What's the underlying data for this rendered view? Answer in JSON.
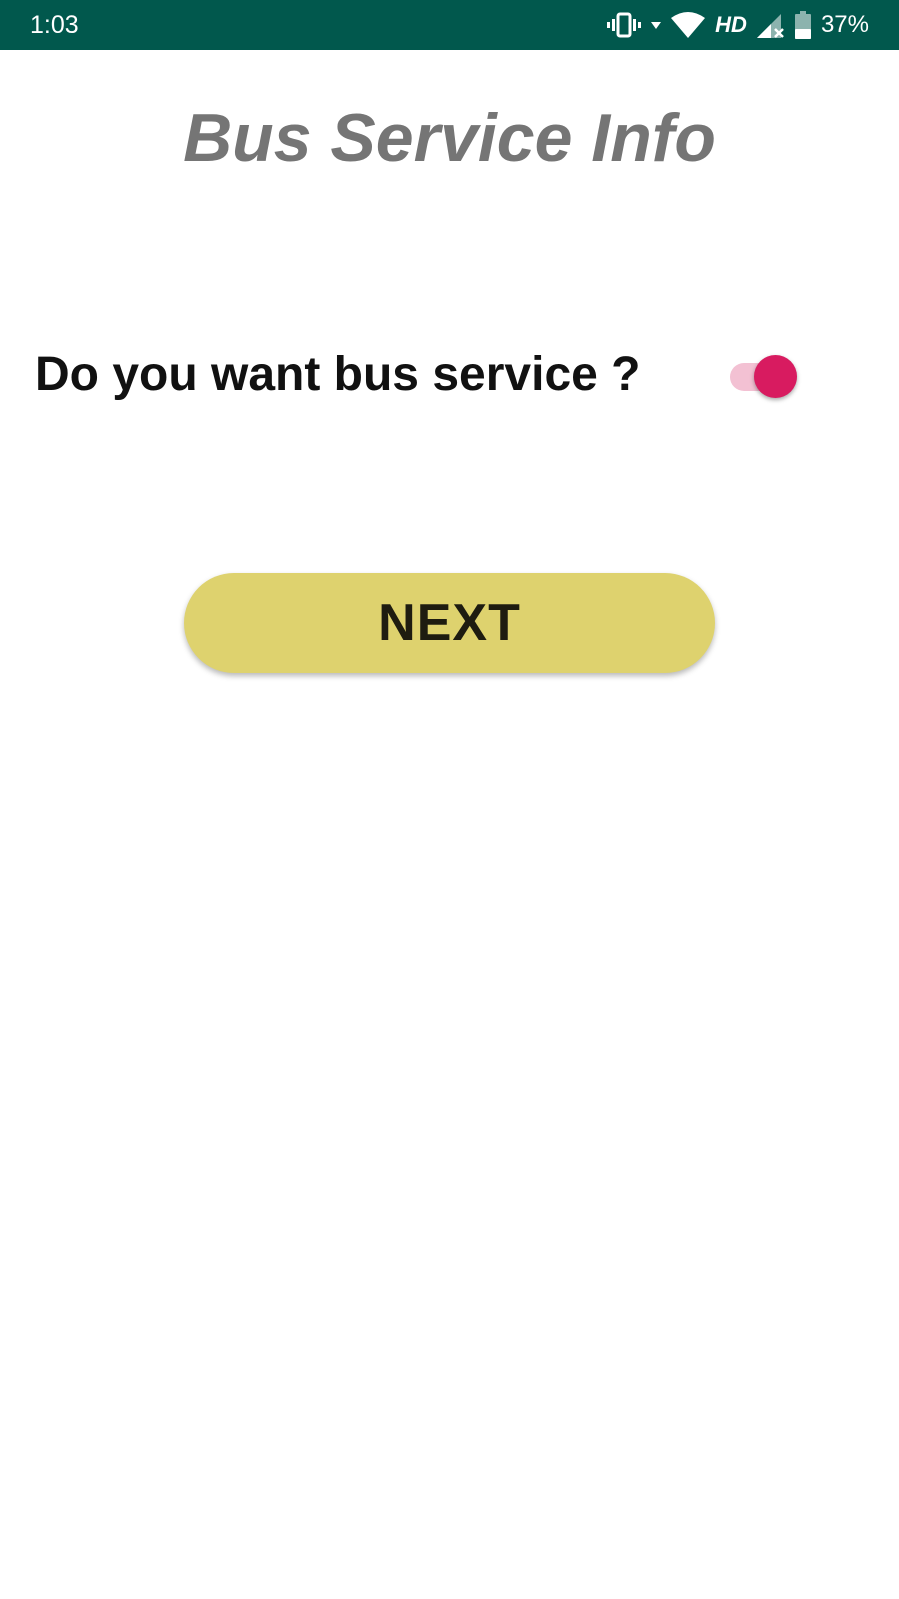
{
  "status_bar": {
    "time": "1:03",
    "network_label": "HD",
    "battery_percent": "37%",
    "icons": [
      "vibrate-icon",
      "wifi-icon",
      "signal-icon",
      "battery-icon"
    ]
  },
  "page": {
    "title": "Bus Service Info"
  },
  "bus_service": {
    "question": "Do you want bus service ?",
    "enabled": true
  },
  "actions": {
    "next_label": "NEXT"
  },
  "colors": {
    "status_bar_bg": "#01584d",
    "title": "#757575",
    "switch_thumb": "#d81b60",
    "switch_track": "#f3c1d3",
    "next_button_bg": "#ded26e"
  }
}
